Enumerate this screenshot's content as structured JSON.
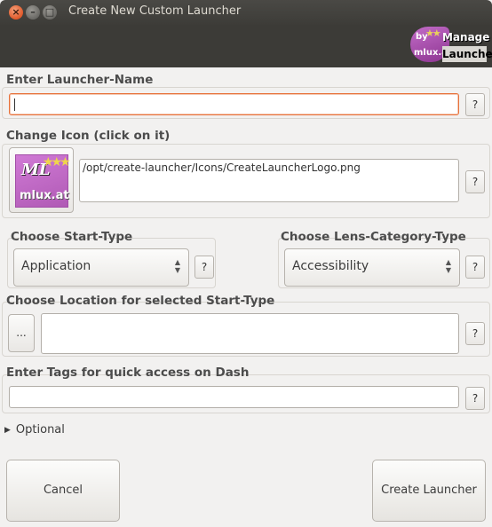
{
  "window": {
    "title": "Create New Custom Launcher",
    "close_glyph": "×",
    "min_glyph": "–",
    "max_glyph": "□"
  },
  "header": {
    "manage_line1": "Manage",
    "manage_line2": "Launcher",
    "logo_by": "by",
    "logo_site": "mlux.at"
  },
  "launcher_name": {
    "label": "Enter Launcher-Name",
    "value": "",
    "help": "?"
  },
  "icon": {
    "label": "Change Icon (click on it)",
    "path": "/opt/create-launcher/Icons/CreateLauncherLogo.png",
    "logo_initials": "ML",
    "logo_site": "mlux.at",
    "help": "?"
  },
  "start_type": {
    "label": "Choose Start-Type",
    "selected": "Application",
    "help": "?"
  },
  "lens_category": {
    "label": "Choose Lens-Category-Type",
    "selected": "Accessibility",
    "help": "?"
  },
  "location": {
    "label": "Choose Location for selected Start-Type",
    "browse": "...",
    "value": "",
    "help": "?"
  },
  "tags": {
    "label": "Enter Tags for quick access on Dash",
    "value": "",
    "help": "?"
  },
  "optional": {
    "label": "Optional"
  },
  "actions": {
    "cancel": "Cancel",
    "create": "Create Launcher"
  }
}
